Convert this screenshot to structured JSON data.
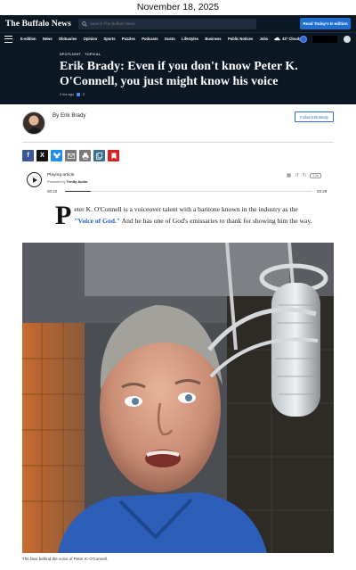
{
  "page": {
    "date": "November 18, 2025"
  },
  "header": {
    "logo": "The Buffalo News",
    "search_placeholder": "Search The Buffalo News",
    "eedition_button": "Read Today's E-edition",
    "nav_items": [
      "E-edition",
      "News",
      "Obituaries",
      "Opinion",
      "Sports",
      "Puzzles",
      "Podcasts",
      "Gusto",
      "Lifestyles",
      "Business",
      "Public Notices",
      "Jobs"
    ],
    "weather": "43° Cloudy"
  },
  "article": {
    "kickers": [
      "SPOTLIGHT",
      "TOPICAL"
    ],
    "headline": "Erik Brady: Even if you don't know Peter K. O'Connell, you just might know his voice",
    "time_ago": "2 hrs ago",
    "comment_count": "2",
    "author": "By Erik Brady",
    "follow_button": "Follow Erik Brady",
    "share_icons": [
      "facebook-icon",
      "x-icon",
      "bluesky-icon",
      "email-icon",
      "print-icon",
      "copy-icon",
      "bookmark-icon"
    ],
    "audio": {
      "label": "Playing article",
      "powered_by_prefix": "Powered by",
      "powered_by": "Trinity Audio",
      "current_time": "00:22",
      "total_time": "03:29",
      "speed": "1.0x",
      "progress": 0.105
    },
    "lede": {
      "dropcap": "P",
      "text_before": "eter K. O'Connell is a voiceover talent with a baritone known in the industry as the ",
      "link": "\"Voice of God.\"",
      "text_after": " And he has one of God's emissaries to thank for showing him the way."
    },
    "photo_caption": "The face behind the voice of Peter K. O'Connell."
  },
  "colors": {
    "navy": "#0c1724",
    "accent_blue": "#1f6fd1",
    "facebook": "#3b5998",
    "x": "#111111",
    "bluesky": "#1d8ef0",
    "email": "#7a7a7a",
    "print": "#7a7a7a",
    "copy": "#3d6f8f",
    "bookmark": "#d32020"
  }
}
